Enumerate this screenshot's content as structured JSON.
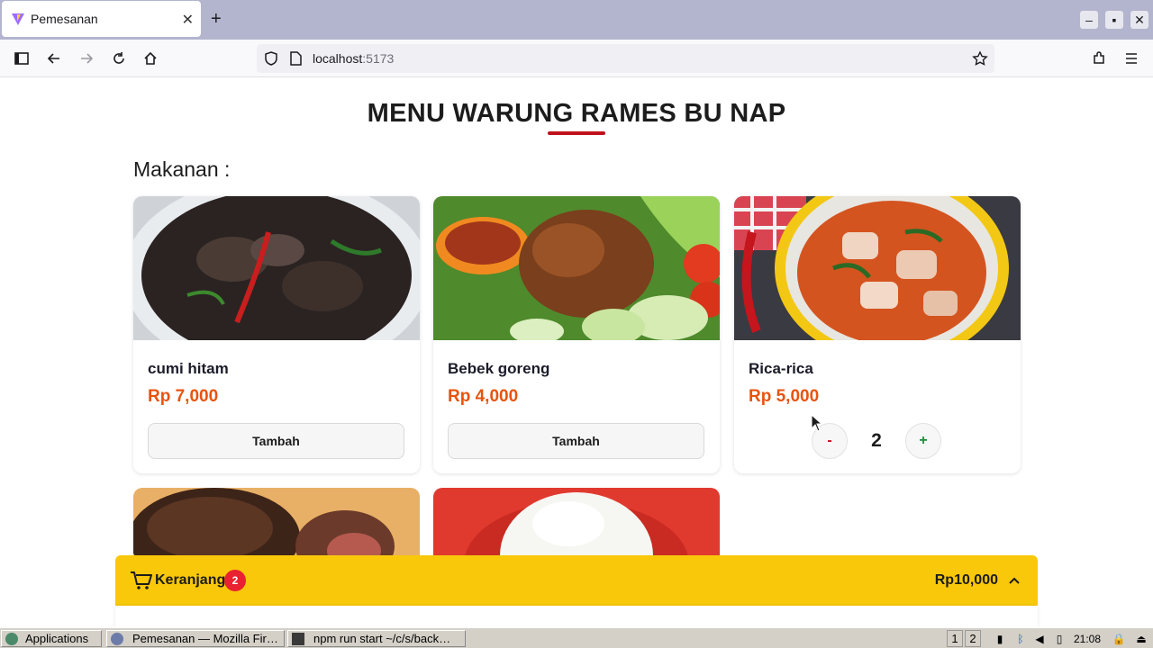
{
  "browser": {
    "tab_title": "Pemesanan",
    "url_host": "localhost",
    "url_port": ":5173"
  },
  "page": {
    "title": "MENU WARUNG RAMES BU NAP",
    "section_label": "Makanan :",
    "accent_color": "#c0121c",
    "price_color": "#e8530e"
  },
  "menu": [
    {
      "name": "cumi hitam",
      "price": "Rp 7,000",
      "button": "Tambah"
    },
    {
      "name": "Bebek goreng",
      "price": "Rp 4,000",
      "button": "Tambah"
    },
    {
      "name": "Rica-rica",
      "price": "Rp 5,000",
      "minus": "-",
      "quantity": "2",
      "plus": "+"
    }
  ],
  "cart": {
    "label": "Keranjang",
    "count": "2",
    "total": "Rp10,000",
    "bar_color": "#f9c80a"
  },
  "taskbar": {
    "apps_label": "Applications",
    "task1": "Pemesanan — Mozilla Fir…",
    "task2": "npm run start ~/c/s/back…",
    "ws1": "1",
    "ws2": "2",
    "clock": "21:08"
  }
}
